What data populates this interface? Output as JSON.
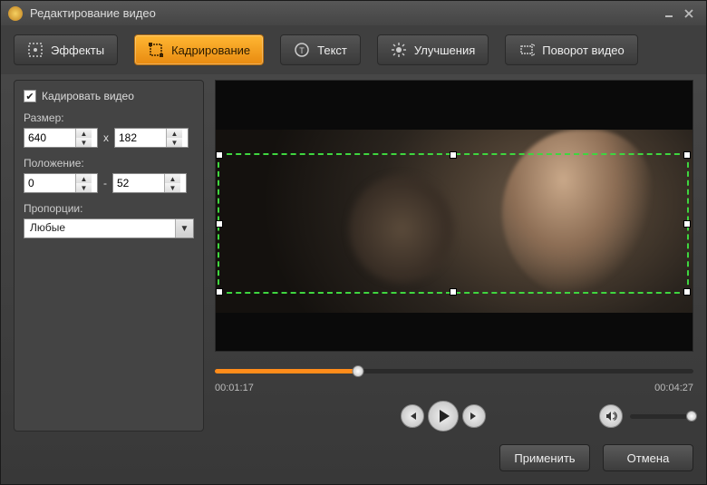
{
  "window": {
    "title": "Редактирование видео"
  },
  "tabs": {
    "effects": "Эффекты",
    "crop": "Кадрирование",
    "text": "Текст",
    "enhance": "Улучшения",
    "rotate": "Поворот видео"
  },
  "panel": {
    "crop_checkbox": "Кадировать видео",
    "size_label": "Размер:",
    "width": "640",
    "sep_x": "x",
    "height": "182",
    "position_label": "Положение:",
    "pos_x": "0",
    "sep_dash": "-",
    "pos_y": "52",
    "aspect_label": "Пропорции:",
    "aspect_value": "Любые"
  },
  "player": {
    "current": "00:01:17",
    "total": "00:04:27"
  },
  "footer": {
    "apply": "Применить",
    "cancel": "Отмена"
  }
}
